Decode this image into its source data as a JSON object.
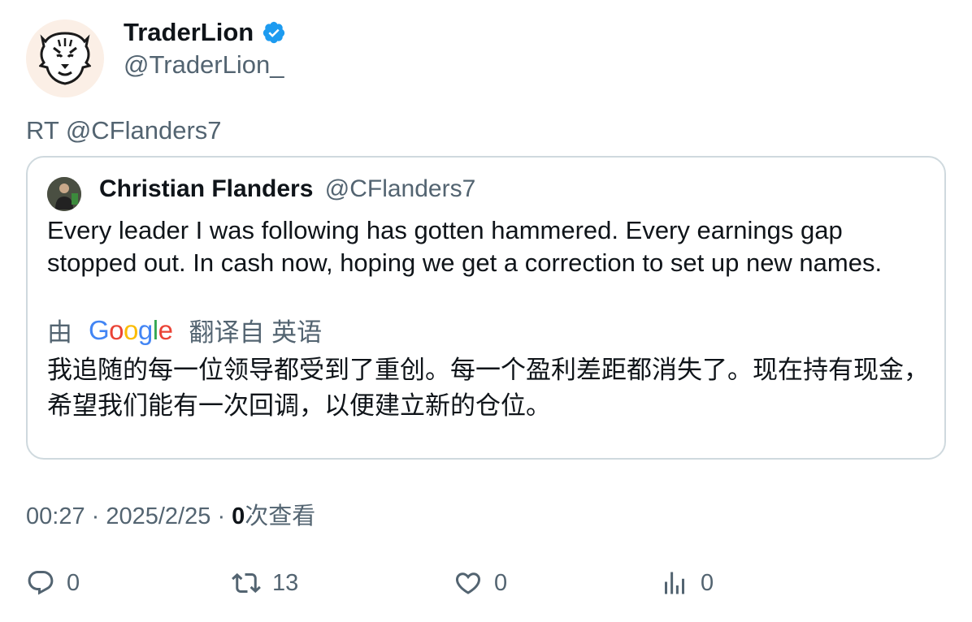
{
  "author": {
    "display_name": "TraderLion",
    "handle": "@TraderLion_",
    "avatar_icon": "lion-logo-icon",
    "verified_icon": "verified-badge-icon"
  },
  "retweet_line": "RT @CFlanders7",
  "quoted_tweet": {
    "display_name": "Christian Flanders",
    "handle": "@CFlanders7",
    "text": "Every leader I was following has gotten hammered. Every earnings gap stopped out. In cash now, hoping we get a correction to set up new names."
  },
  "translation": {
    "prefix": "由",
    "provider_logo": "Google",
    "suffix": "翻译自 英语",
    "text": "我追随的每一位领导都受到了重创。每一个盈利差距都消失了。现在持有现金，希望我们能有一次回调，以便建立新的仓位。"
  },
  "meta": {
    "time": "00:27",
    "date": "2025/2/25",
    "views_count": "0",
    "views_label": "次查看"
  },
  "actions": {
    "replies": "0",
    "retweets": "13",
    "likes": "0",
    "views": "0"
  },
  "colors": {
    "verified_blue": "#1d9bf0",
    "secondary_text": "#536471",
    "border": "#cfd9de"
  }
}
